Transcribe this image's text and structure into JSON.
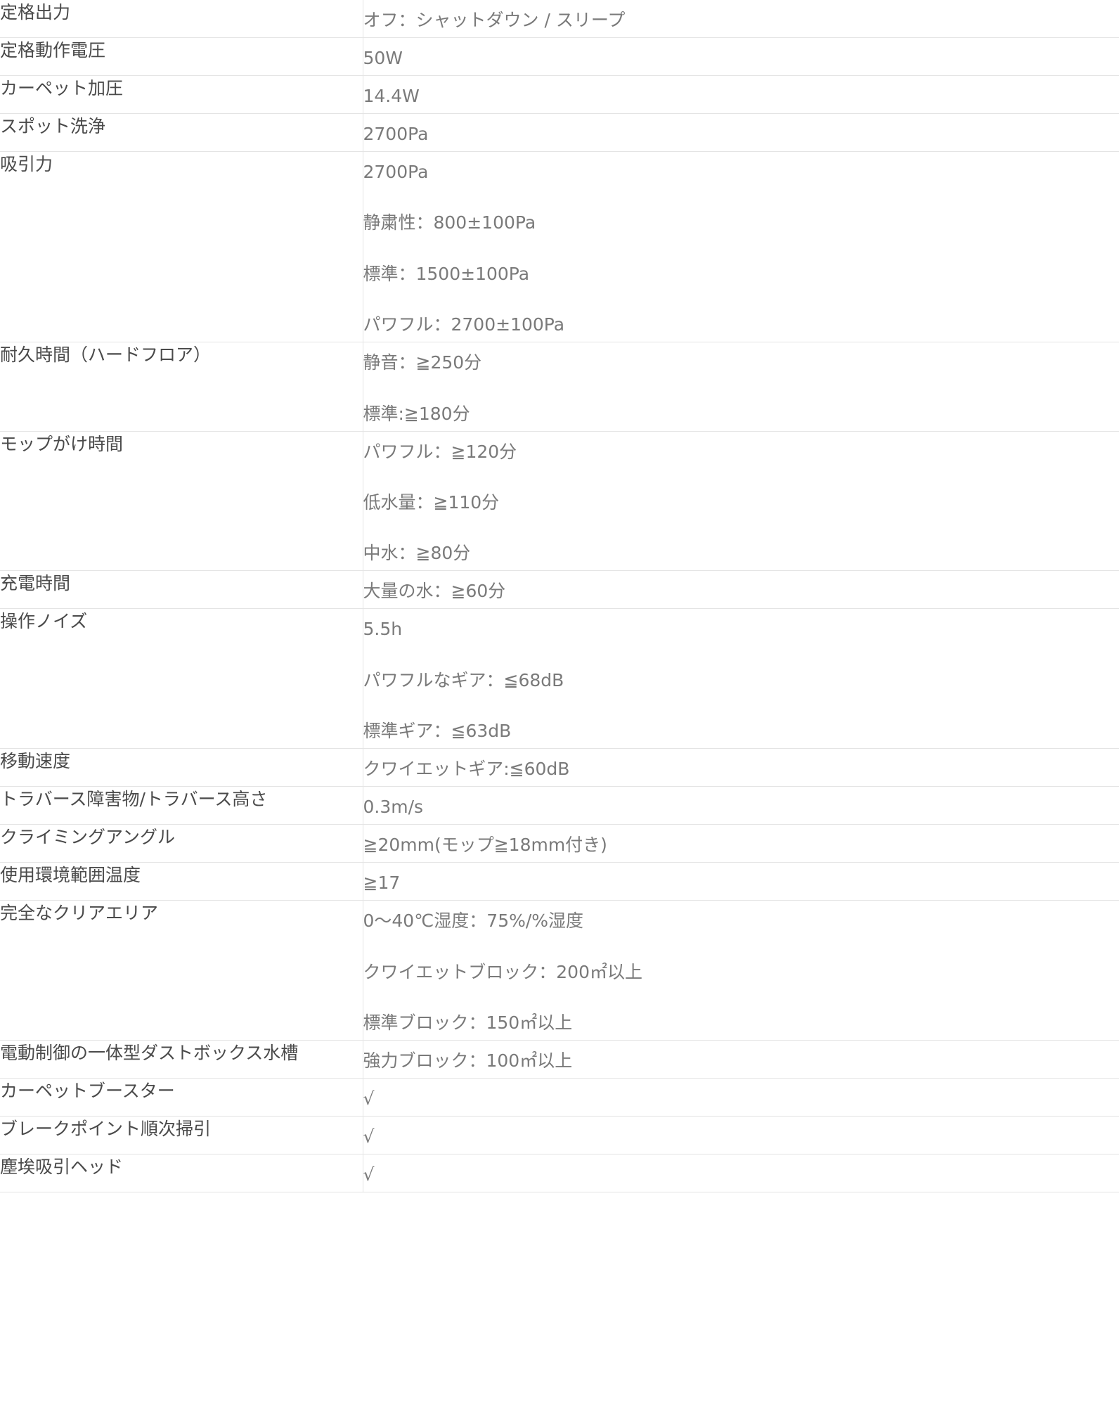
{
  "spec_table": {
    "rows": [
      {
        "label": "定格出力",
        "values": [
          "オフ：シャットダウン / スリープ"
        ]
      },
      {
        "label": "定格動作電圧",
        "values": [
          "50W"
        ]
      },
      {
        "label": "カーペット加圧",
        "values": [
          "14.4W"
        ]
      },
      {
        "label": "スポット洗浄",
        "values": [
          "2700Pa"
        ]
      },
      {
        "label": "吸引力",
        "values": [
          "2700Pa",
          "静粛性：800±100Pa",
          "標準：1500±100Pa",
          "パワフル：2700±100Pa"
        ]
      },
      {
        "label": "耐久時間（ハードフロア）",
        "values": [
          "静音：≧250分",
          "標準:≧180分"
        ]
      },
      {
        "label": "モップがけ時間",
        "values": [
          "パワフル：≧120分",
          "低水量：≧110分",
          "中水：≧80分"
        ]
      },
      {
        "label": "充電時間",
        "values": [
          "大量の水：≧60分"
        ]
      },
      {
        "label": "操作ノイズ",
        "values": [
          "5.5h",
          "パワフルなギア：≦68dB",
          "標準ギア：≦63dB"
        ]
      },
      {
        "label": "移動速度",
        "values": [
          "クワイエットギア:≦60dB"
        ]
      },
      {
        "label": "トラバース障害物/トラバース高さ",
        "values": [
          "0.3m/s"
        ]
      },
      {
        "label": "クライミングアングル",
        "values": [
          "≧20mm(モップ≧18mm付き)"
        ]
      },
      {
        "label": "使用環境範囲温度",
        "values": [
          "≧17"
        ]
      },
      {
        "label": "完全なクリアエリア",
        "values": [
          "0～40℃湿度：75%/%湿度",
          "クワイエットブロック：200㎡以上",
          "標準ブロック：150㎡以上"
        ]
      },
      {
        "label": "電動制御の一体型ダストボックス水槽",
        "values": [
          "強力ブロック：100㎡以上"
        ]
      },
      {
        "label": "カーペットブースター",
        "values": [
          "√"
        ]
      },
      {
        "label": "ブレークポイント順次掃引",
        "values": [
          "√"
        ]
      },
      {
        "label": "塵埃吸引ヘッド",
        "values": [
          "√"
        ]
      }
    ]
  }
}
